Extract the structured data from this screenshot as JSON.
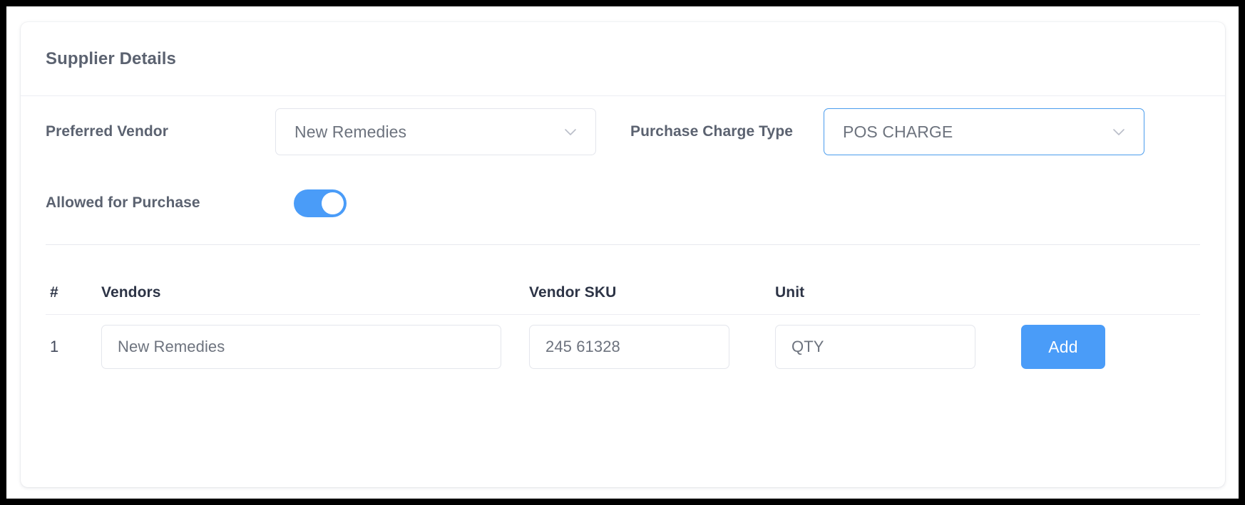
{
  "card": {
    "title": "Supplier Details"
  },
  "form": {
    "preferred_vendor": {
      "label": "Preferred Vendor",
      "value": "New Remedies",
      "icon": "chevron-down-icon"
    },
    "purchase_charge_type": {
      "label": "Purchase Charge Type",
      "value": "POS CHARGE",
      "icon": "chevron-down-icon",
      "focused": true
    },
    "allowed_for_purchase": {
      "label": "Allowed for Purchase",
      "state": "on"
    }
  },
  "table": {
    "headers": {
      "num": "#",
      "vendors": "Vendors",
      "vendor_sku": "Vendor SKU",
      "unit": "Unit"
    },
    "rows": [
      {
        "num": "1",
        "vendor": "New Remedies",
        "sku": "245 61328",
        "unit": "QTY",
        "action": "Add"
      }
    ]
  },
  "colors": {
    "accent": "#4a9cf8",
    "focus_border": "#4a9ced",
    "title_text": "#5b6270",
    "header_text": "#2d3446",
    "input_text": "#6d737e",
    "border": "#e4e6ec"
  }
}
